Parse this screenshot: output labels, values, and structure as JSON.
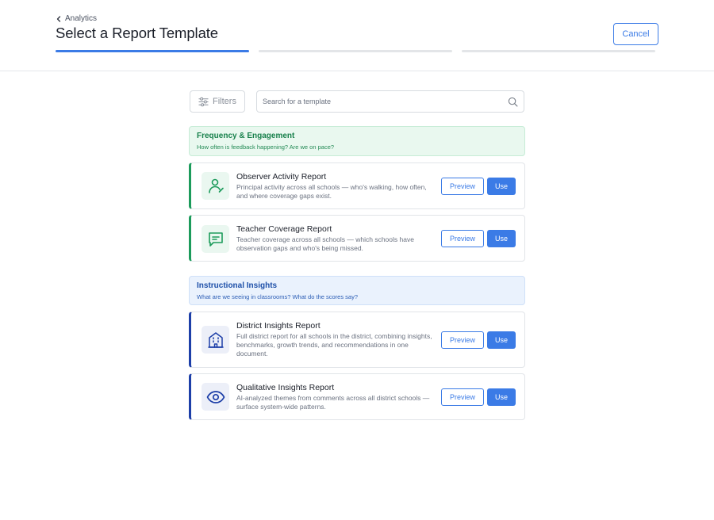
{
  "header": {
    "breadcrumb": "Analytics",
    "title": "Select a Report Template",
    "cancel_label": "Cancel",
    "steps_total": 3,
    "active_step": 1
  },
  "toolbar": {
    "filters_label": "Filters",
    "search_placeholder": "Search for a template",
    "search_value": ""
  },
  "categories": [
    {
      "title": "Frequency & Engagement",
      "subtitle": "How often is feedback happening? Are we on pace?",
      "color": "#1c9b5b",
      "templates": [
        {
          "icon": "person-icon",
          "title": "Observer Activity Report",
          "description": "Principal activity across all schools — who's walking, how often, and where coverage gaps exist.",
          "preview_label": "Preview",
          "use_label": "Use"
        },
        {
          "icon": "chat-icon",
          "title": "Teacher Coverage Report",
          "description": "Teacher coverage across all schools — which schools have observation gaps and who's being missed.",
          "preview_label": "Preview",
          "use_label": "Use"
        }
      ]
    },
    {
      "title": "Instructional Insights",
      "subtitle": "What are we seeing in classrooms? What do the scores say?",
      "color": "#1d3fa8",
      "templates": [
        {
          "icon": "building-icon",
          "title": "District Insights Report",
          "description": "Full district report for all schools in the district, combining insights, benchmarks, growth trends, and recommendations in one document.",
          "preview_label": "Preview",
          "use_label": "Use"
        },
        {
          "icon": "eye-icon",
          "title": "Qualitative Insights Report",
          "description": "AI-analyzed themes from comments across all district schools — surface system-wide patterns.",
          "preview_label": "Preview",
          "use_label": "Use"
        }
      ]
    }
  ],
  "colors": {
    "accent": "#3b7be6",
    "green": "#1c9b5b",
    "navy": "#1d3fa8"
  }
}
